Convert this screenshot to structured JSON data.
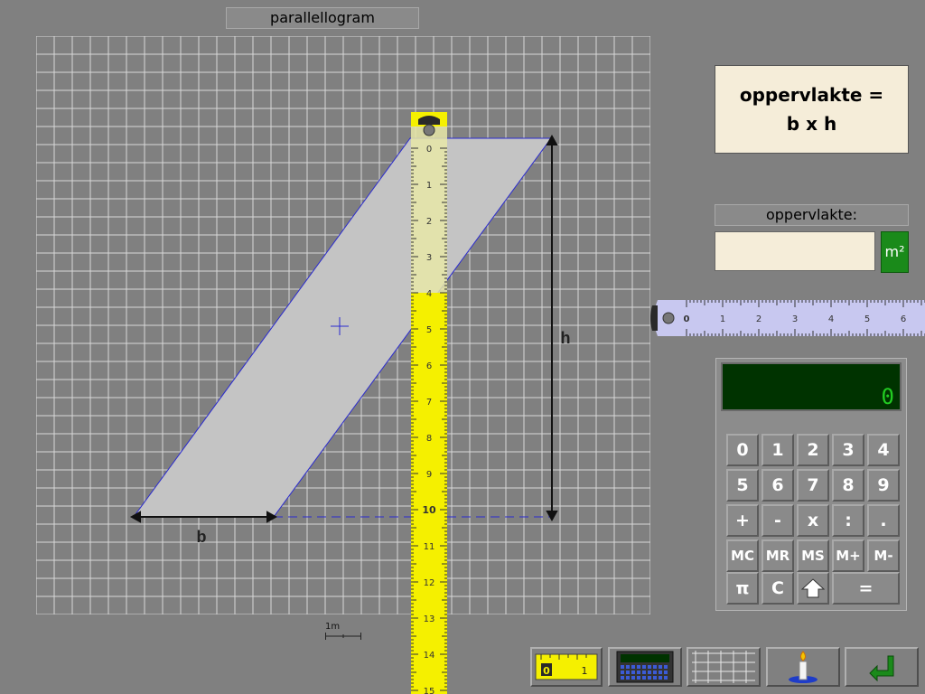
{
  "title": "parallellogram",
  "shape": {
    "base_label": "b",
    "height_label": "h"
  },
  "scale": {
    "label": "1m"
  },
  "formula": {
    "line1": "oppervlakte =",
    "line2": "b x h"
  },
  "answer": {
    "label": "oppervlakte:",
    "value": "",
    "placeholder": "",
    "unit": "m²"
  },
  "ruler_horizontal": {
    "ticks": [
      "0",
      "1",
      "2",
      "3",
      "4",
      "5",
      "6"
    ]
  },
  "ruler_vertical": {
    "ticks": [
      "0",
      "1",
      "2",
      "3",
      "4",
      "5",
      "6",
      "7",
      "8",
      "9",
      "10",
      "11",
      "12",
      "13",
      "14",
      "15"
    ]
  },
  "calculator": {
    "display": "0",
    "rows": [
      [
        "0",
        "1",
        "2",
        "3",
        "4"
      ],
      [
        "5",
        "6",
        "7",
        "8",
        "9"
      ],
      [
        "+",
        "-",
        "x",
        ":",
        "."
      ],
      [
        "MC",
        "MR",
        "MS",
        "M+",
        "M-"
      ]
    ],
    "last_row": {
      "pi": "π",
      "clear": "C",
      "equals": "="
    }
  },
  "toolbar": {
    "ruler_icon_text": {
      "zero": "0",
      "one": "1"
    }
  },
  "colors": {
    "ruler_yellow": "#f5f000",
    "ruler_lilac": "#c8c8f0",
    "shape_fill": "#c4c4c4",
    "shape_edge": "#2a2ad0",
    "unit_green": "#1a8a1a",
    "display_green": "#003300",
    "answer_bg": "#f5edd9"
  }
}
